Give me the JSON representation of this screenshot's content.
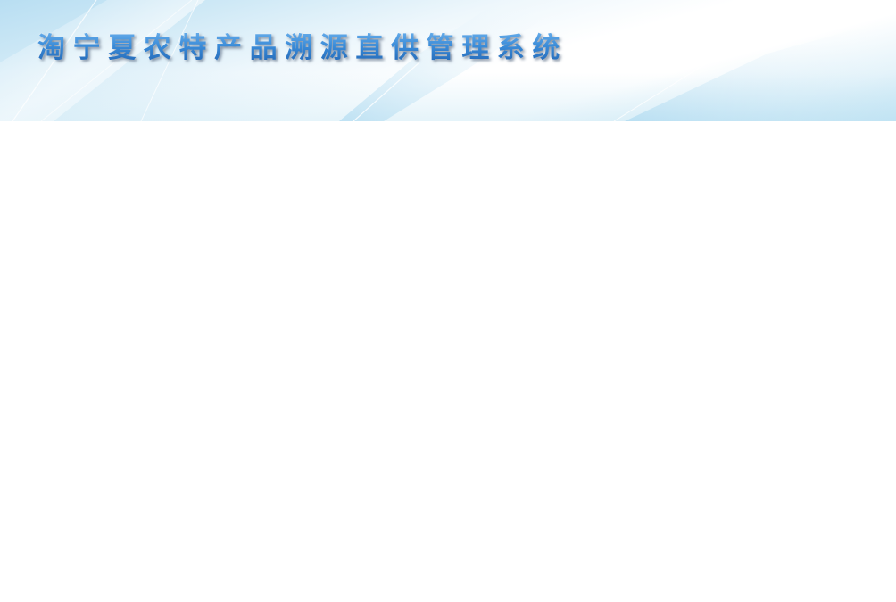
{
  "header": {
    "title": "淘宁夏农特产品溯源直供管理系统"
  },
  "colors": {
    "header_light": "#ffffff",
    "header_blue": "#b8def2",
    "title_blue": "#2a74c4",
    "content_background": "#ffffff"
  }
}
